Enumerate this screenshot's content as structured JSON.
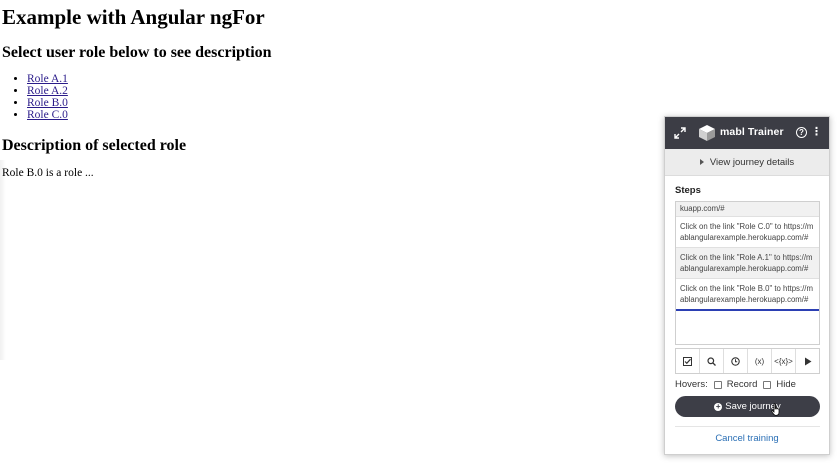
{
  "page": {
    "title": "Example with Angular ngFor",
    "subtitle": "Select user role below to see description",
    "roles": [
      "Role A.1",
      "Role A.2",
      "Role B.0",
      "Role C.0"
    ],
    "description_heading": "Description of selected role",
    "description_text": "Role B.0 is a role ..."
  },
  "trainer": {
    "title": "mabl Trainer",
    "help_glyph": "?",
    "more_glyph": "⋮",
    "view_journey_label": "View journey details",
    "steps_label": "Steps",
    "steps": [
      "kuapp.com/#",
      "Click on the link \"Role C.0\" to https://mablangularexample.herokuapp.com/#",
      "Click on the link \"Role A.1\" to https://mablangularexample.herokuapp.com/#",
      "Click on the link \"Role B.0\" to https://mablangularexample.herokuapp.com/#"
    ],
    "tools": {
      "variable": "(x)",
      "code": "<{x}>"
    },
    "hovers_label": "Hovers:",
    "record_label": "Record",
    "hide_label": "Hide",
    "save_label": "Save journey",
    "cancel_label": "Cancel training",
    "colors": {
      "header": "#3c3d45",
      "accent": "#2b3fb3",
      "link": "#2a6fb5"
    }
  }
}
